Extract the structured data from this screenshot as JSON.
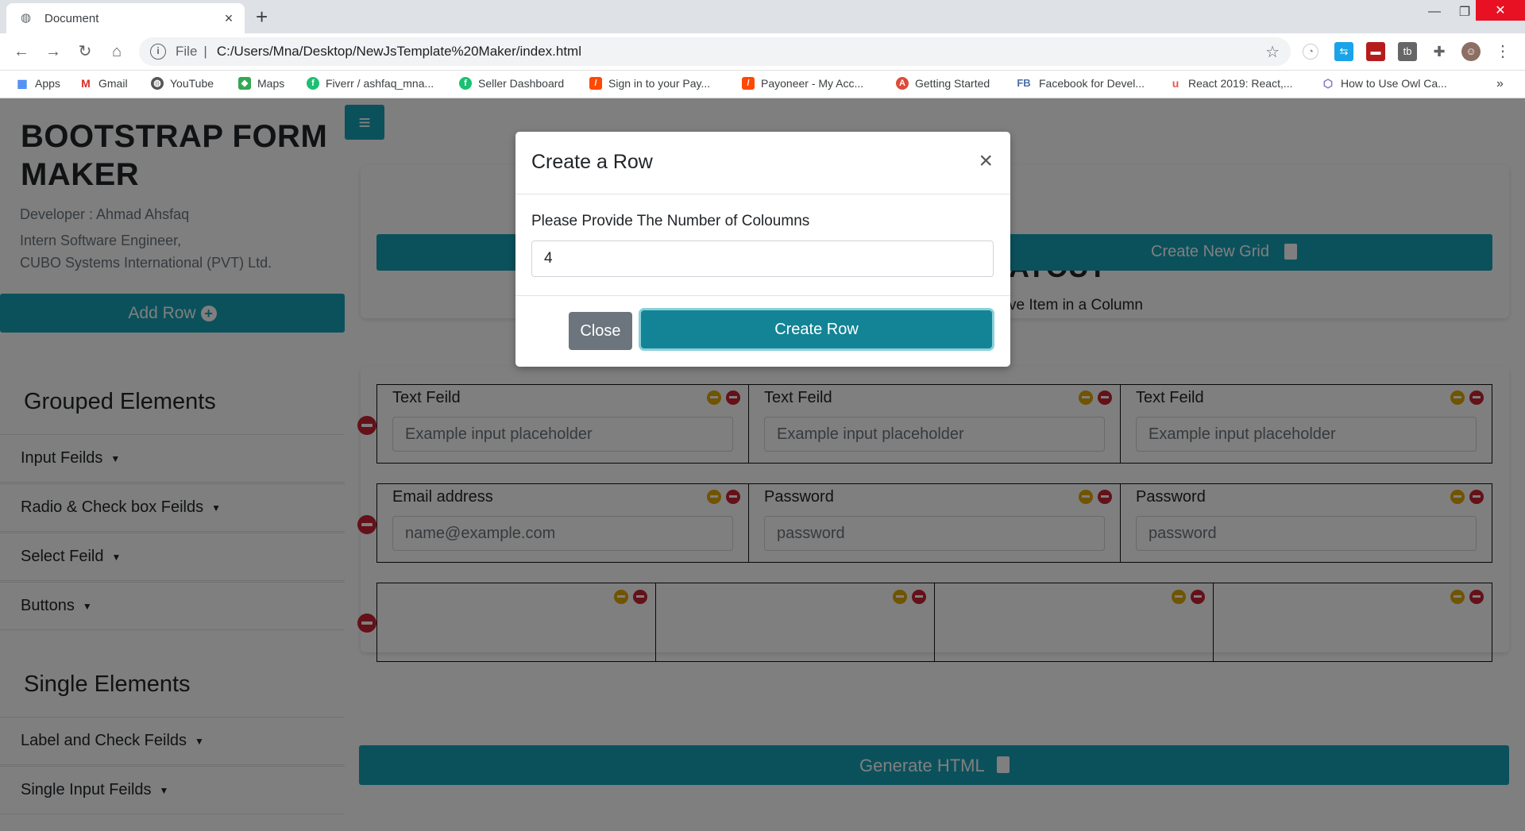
{
  "browser": {
    "tab_title": "Document",
    "scheme": "File",
    "url": "C:/Users/Mna/Desktop/NewJsTemplate%20Maker/index.html",
    "bookmarks": [
      {
        "label": "Apps",
        "icon": "apps-grid-icon"
      },
      {
        "label": "Gmail",
        "icon": "gmail-icon"
      },
      {
        "label": "YouTube",
        "icon": "youtube-icon"
      },
      {
        "label": "Maps",
        "icon": "maps-icon"
      },
      {
        "label": "Fiverr / ashfaq_mna...",
        "icon": "fiverr-icon"
      },
      {
        "label": "Seller Dashboard",
        "icon": "fiverr-icon"
      },
      {
        "label": "Sign in to your Pay...",
        "icon": "payoneer-icon"
      },
      {
        "label": "Payoneer - My Acc...",
        "icon": "payoneer-icon"
      },
      {
        "label": "Getting Started",
        "icon": "angular-icon"
      },
      {
        "label": "Facebook for Devel...",
        "icon": "fb-icon"
      },
      {
        "label": "React 2019: React,...",
        "icon": "udemy-icon"
      },
      {
        "label": "How to Use Owl Ca...",
        "icon": "owl-icon"
      }
    ],
    "bookmark_fb_text": "FB",
    "more": "»"
  },
  "sidebar": {
    "brand": "BOOTSTRAP FORM MAKER",
    "developer": "Developer : Ahmad Ahsfaq",
    "role": "Intern Software Engineer,",
    "company": "CUBO Systems International (PVT) Ltd.",
    "add_row": "Add Row",
    "grouped_title": "Grouped Elements",
    "grouped_items": [
      "Input Feilds",
      "Radio & Check box Feilds",
      "Select Feild",
      "Buttons"
    ],
    "single_title": "Single Elements",
    "single_items": [
      "Label and Check Feilds",
      "Single Input Feilds"
    ]
  },
  "main": {
    "layout_title_visible": "AYOUT",
    "create_grid": "Create New Grid",
    "move_hint_visible": "ve Item in a Column",
    "generate_html": "Generate HTML",
    "rows": [
      {
        "cols": [
          {
            "label": "Text Feild",
            "placeholder": "Example input placeholder"
          },
          {
            "label": "Text Feild",
            "placeholder": "Example input placeholder"
          },
          {
            "label": "Text Feild",
            "placeholder": "Example input placeholder"
          }
        ]
      },
      {
        "cols": [
          {
            "label": "Email address",
            "placeholder": "name@example.com"
          },
          {
            "label": "Password",
            "placeholder": "password"
          },
          {
            "label": "Password",
            "placeholder": "password"
          }
        ]
      },
      {
        "cols": [
          {},
          {},
          {},
          {}
        ]
      }
    ]
  },
  "modal": {
    "title": "Create a Row",
    "close_symbol": "×",
    "label": "Please Provide The Number of Coloumns",
    "input_value": "4",
    "close_btn": "Close",
    "create_btn": "Create Row"
  },
  "colors": {
    "accent": "#17a2b8",
    "danger": "#c82333",
    "warning": "#e0a800",
    "secondary": "#6c757d"
  }
}
